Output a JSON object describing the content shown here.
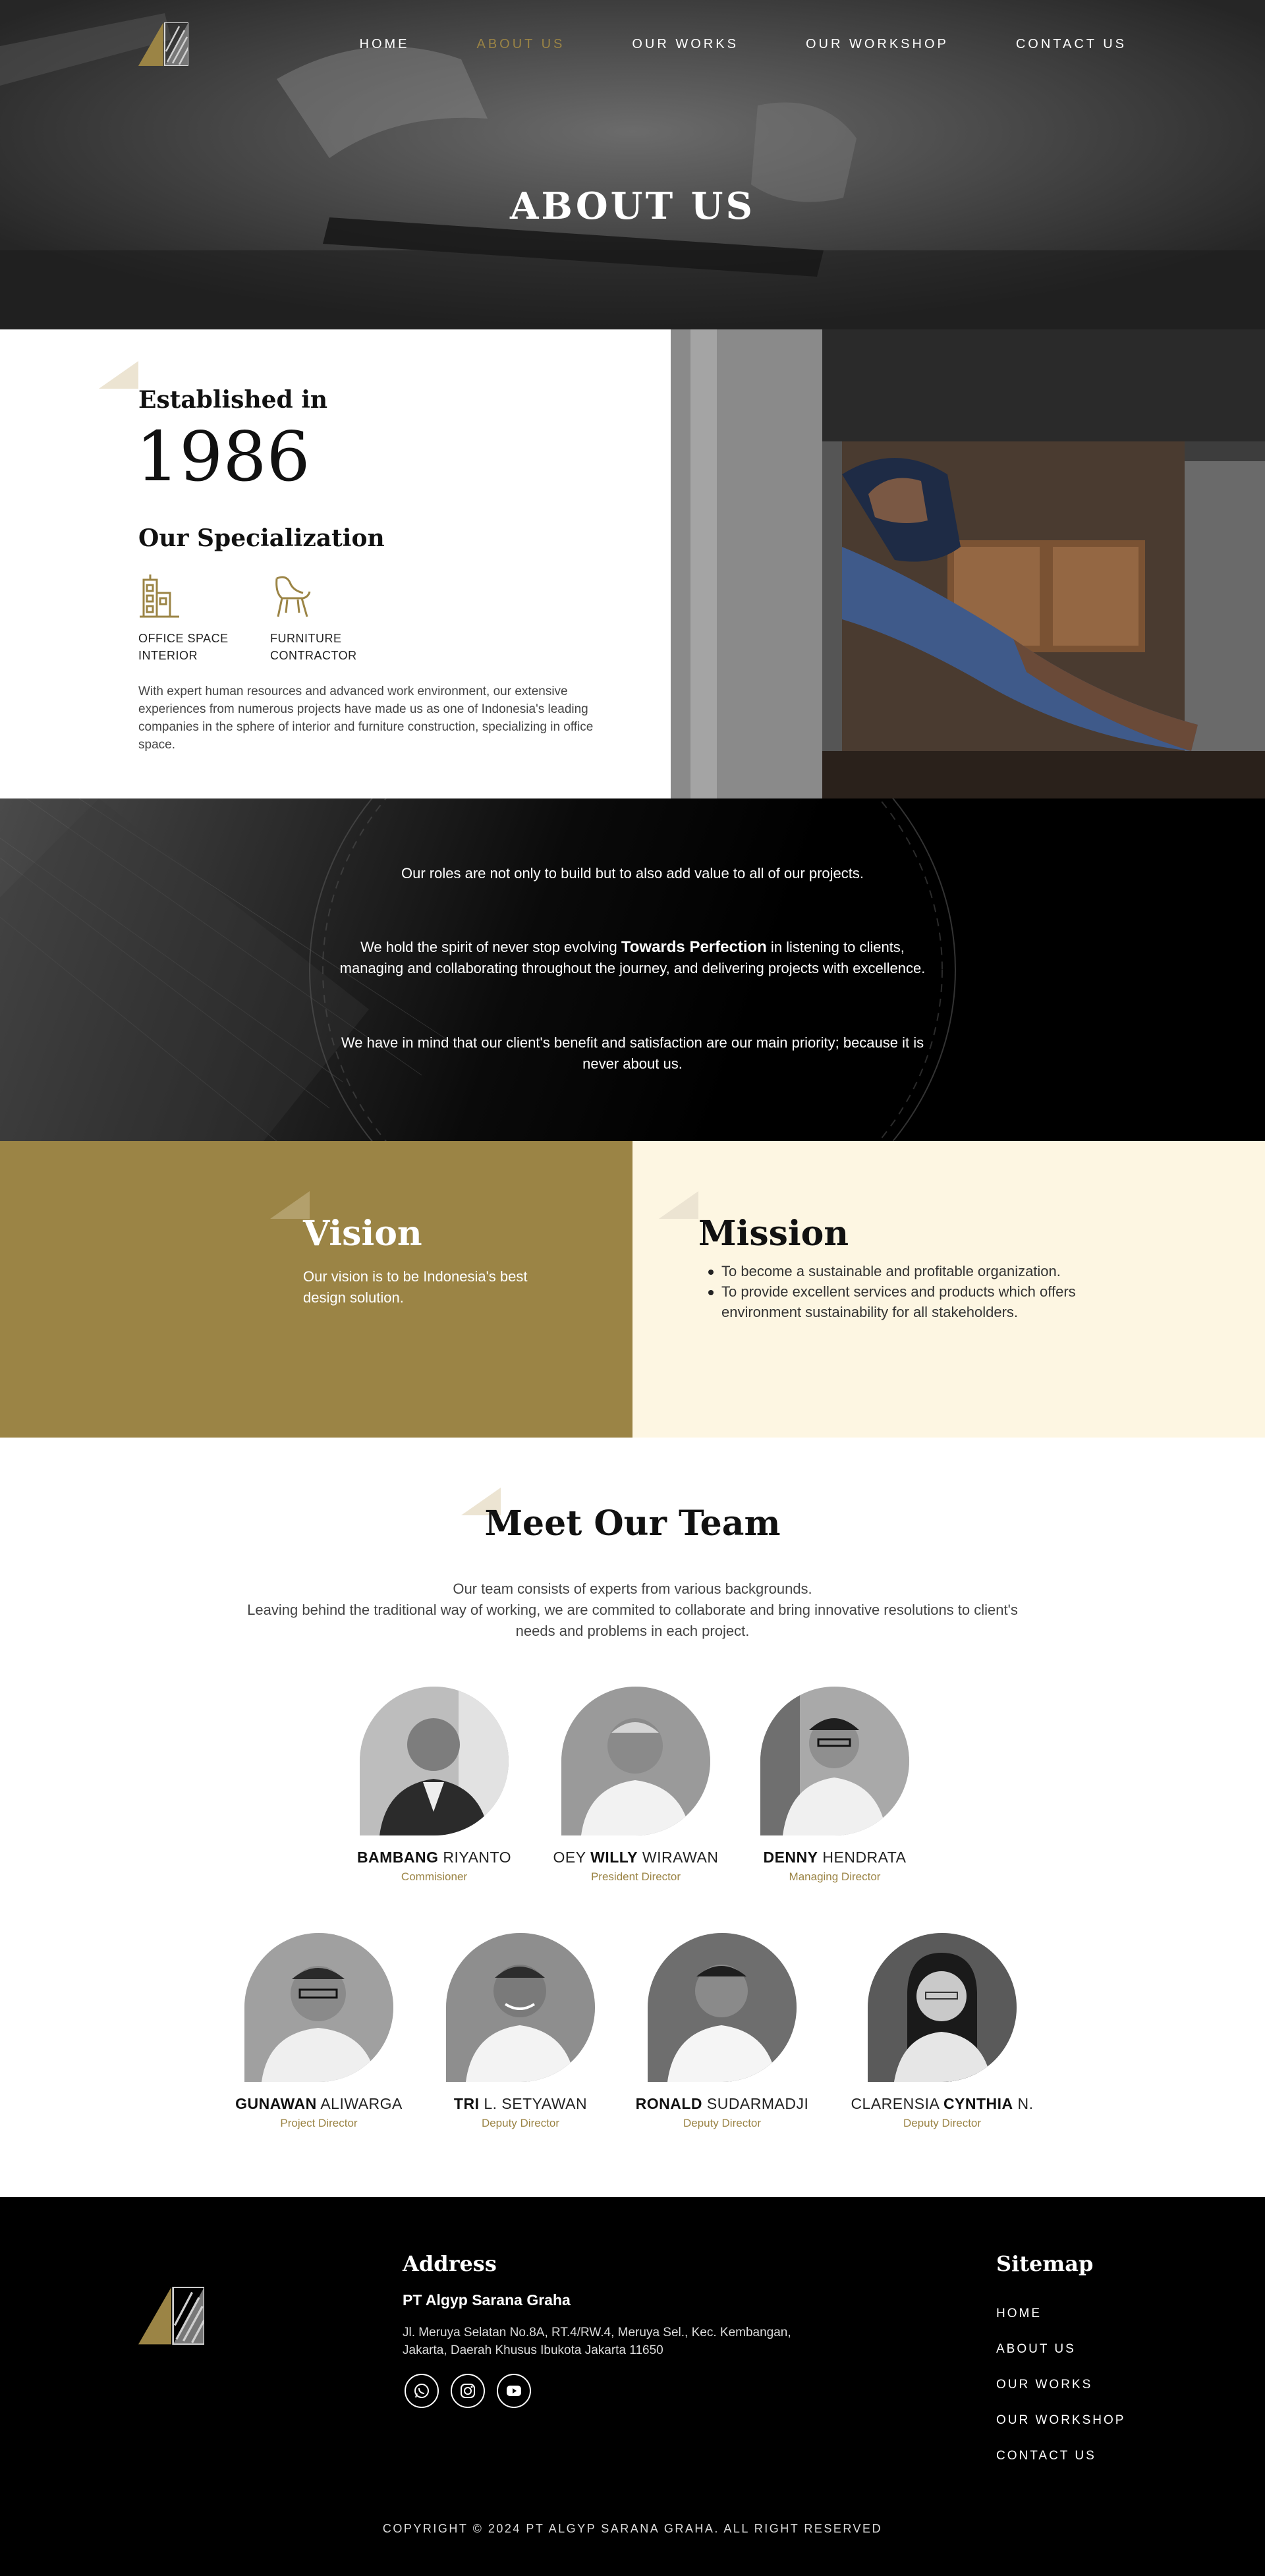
{
  "brand": {
    "gold": "#9b8445",
    "cream": "#fdf6e2",
    "black": "#000000"
  },
  "nav": {
    "items": [
      {
        "label": "HOME",
        "active": false
      },
      {
        "label": "ABOUT US",
        "active": true
      },
      {
        "label": "OUR WORKS",
        "active": false
      },
      {
        "label": "OUR WORKSHOP",
        "active": false
      },
      {
        "label": "CONTACT US",
        "active": false
      }
    ]
  },
  "hero": {
    "title": "ABOUT US"
  },
  "established": {
    "label": "Established in",
    "year": "1986",
    "specialization_title": "Our Specialization",
    "specializations": [
      {
        "icon": "office-building-icon",
        "label": "OFFICE SPACE\nINTERIOR"
      },
      {
        "icon": "chair-icon",
        "label": "FURNITURE\nCONTRACTOR"
      }
    ],
    "description": "With expert human resources and advanced work environment, our extensive experiences from numerous projects have made us as one of Indonesia's leading companies in the sphere of interior and furniture construction, specializing in office space."
  },
  "roles": {
    "p1": "Our roles are not only to build but to also add value to all of our projects.",
    "p2_before": "We hold the spirit of never stop evolving ",
    "p2_bold": "Towards Perfection",
    "p2_after": " in listening to clients, managing and collaborating throughout the journey, and delivering projects with excellence.",
    "p3": "We have in mind that our client's benefit and satisfaction are our main priority; because it is never about us."
  },
  "vision": {
    "title": "Vision",
    "text": "Our vision is to be Indonesia's best design solution."
  },
  "mission": {
    "title": "Mission",
    "items": [
      "To become a sustainable and profitable organization.",
      "To provide excellent services and products which offers environment sustainability for all stakeholders."
    ]
  },
  "team": {
    "title": "Meet Our Team",
    "intro": "Our team consists of experts from various backgrounds.\nLeaving behind the traditional way of working, we are commited to collaborate and bring innovative resolutions to client's needs and problems in each project.",
    "members": [
      {
        "pre": "",
        "bold": "BAMBANG",
        "post": " RIYANTO",
        "role": "Commisioner"
      },
      {
        "pre": "OEY ",
        "bold": "WILLY",
        "post": " WIRAWAN",
        "role": "President Director"
      },
      {
        "pre": "",
        "bold": "DENNY",
        "post": " HENDRATA",
        "role": "Managing Director"
      },
      {
        "pre": "",
        "bold": "GUNAWAN",
        "post": " ALIWARGA",
        "role": "Project Director"
      },
      {
        "pre": "",
        "bold": "TRI",
        "post": " L. SETYAWAN",
        "role": "Deputy Director"
      },
      {
        "pre": "",
        "bold": "RONALD",
        "post": " SUDARMADJI",
        "role": "Deputy Director"
      },
      {
        "pre": "CLARENSIA ",
        "bold": "CYNTHIA",
        "post": " N.",
        "role": "Deputy Director"
      }
    ]
  },
  "footer": {
    "address_title": "Address",
    "company": "PT Algyp Sarana Graha",
    "address": "Jl. Meruya Selatan No.8A, RT.4/RW.4, Meruya Sel., Kec. Kembangan, Jakarta, Daerah Khusus Ibukota Jakarta 11650",
    "socials": [
      "whatsapp-icon",
      "instagram-icon",
      "youtube-icon"
    ],
    "sitemap_title": "Sitemap",
    "sitemap": [
      "HOME",
      "ABOUT US",
      "OUR WORKS",
      "OUR WORKSHOP",
      "CONTACT US"
    ],
    "copyright": "COPYRIGHT © 2024 PT ALGYP SARANA GRAHA. ALL RIGHT RESERVED"
  }
}
